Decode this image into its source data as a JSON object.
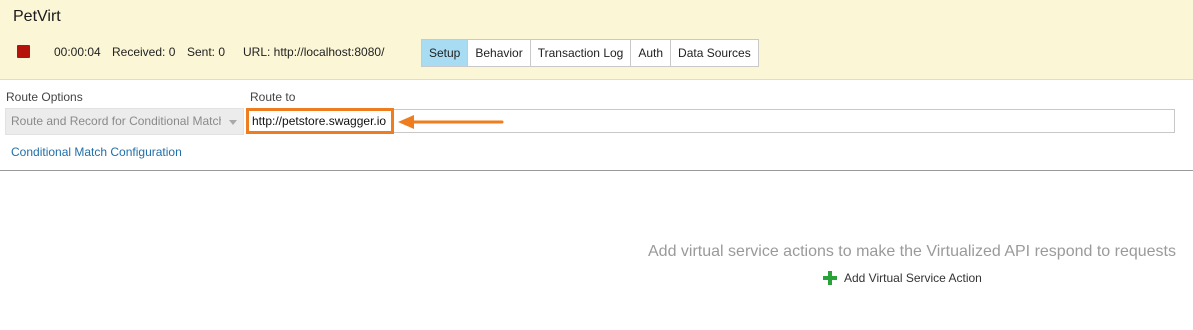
{
  "header": {
    "title": "PetVirt",
    "timer": "00:00:04",
    "received": "Received: 0",
    "sent": "Sent: 0",
    "url": "URL: http://localhost:8080/",
    "stop_color": "#b5120c"
  },
  "tabs": [
    {
      "label": "Setup",
      "active": true
    },
    {
      "label": "Behavior",
      "active": false
    },
    {
      "label": "Transaction Log",
      "active": false
    },
    {
      "label": "Auth",
      "active": false
    },
    {
      "label": "Data Sources",
      "active": false
    }
  ],
  "route": {
    "options_label": "Route Options",
    "route_to_label": "Route to",
    "selected_option": "Route and Record for Conditional Match",
    "route_to_value": "http://petstore.swagger.io",
    "conditional_link": "Conditional Match Configuration",
    "highlight_color": "#ee7d1f"
  },
  "empty_state": {
    "message": "Add virtual service actions to make the Virtualized API respond to requests",
    "add_action_label": "Add Virtual Service Action",
    "add_icon": "plus-icon"
  }
}
